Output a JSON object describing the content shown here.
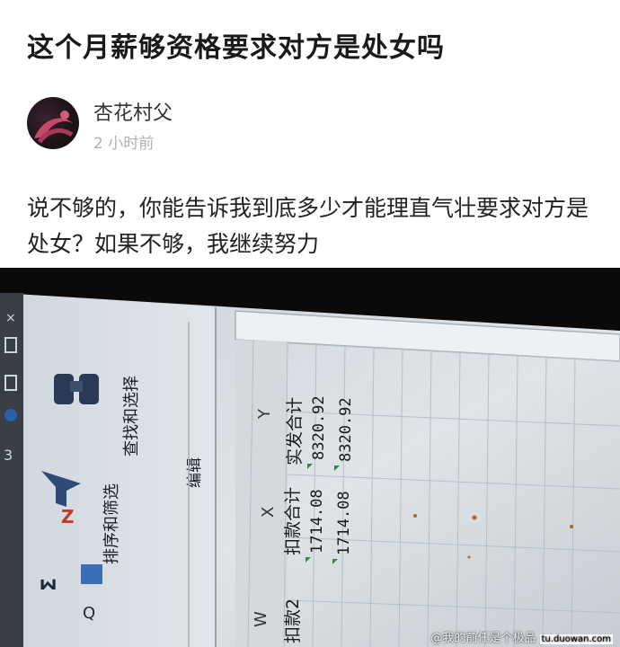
{
  "post": {
    "title": "这个月薪够资格要求对方是处女吗",
    "author": "杏花村父",
    "time": "2 小时前",
    "body": "说不够的，你能告诉我到底多少才能理直气壮要求对方是处女？如果不够，我继续努力"
  },
  "photo": {
    "ribbon": {
      "sort_filter_label": "排序和筛选",
      "find_select_label": "查找和选择",
      "edit_group_label": "编辑"
    },
    "columns": [
      "W",
      "X",
      "Y"
    ],
    "rows": [
      [
        "扣款2",
        "扣款合计",
        "实发合计"
      ],
      [
        "",
        "1714.08",
        "8320.92"
      ],
      [
        "",
        "1714.08",
        "8320.92"
      ]
    ]
  },
  "watermark": {
    "text": "@我的前任是个极品",
    "site": "tu.duowan.com"
  }
}
